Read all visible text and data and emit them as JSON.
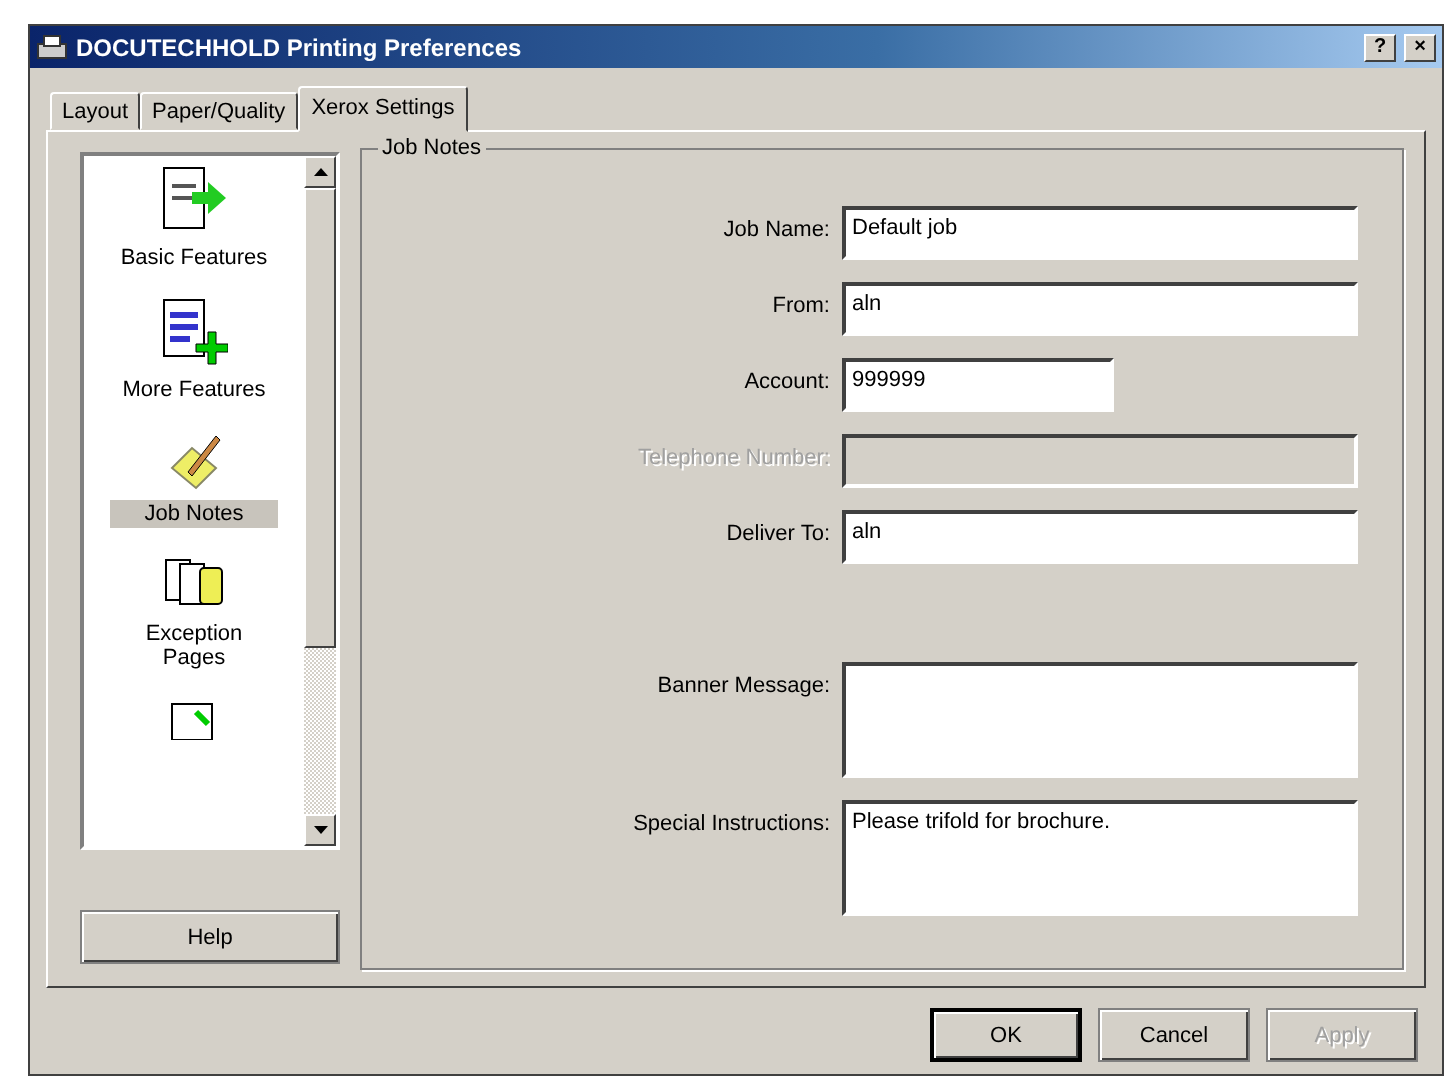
{
  "window": {
    "title": "DOCUTECHHOLD Printing Preferences",
    "help_button": "?",
    "close_button": "×"
  },
  "tabs": [
    {
      "label": "Layout",
      "selected": false
    },
    {
      "label": "Paper/Quality",
      "selected": false
    },
    {
      "label": "Xerox Settings",
      "selected": true
    }
  ],
  "sidebar": {
    "items": [
      {
        "label": "Basic Features",
        "selected": false
      },
      {
        "label": "More Features",
        "selected": false
      },
      {
        "label": "Job Notes",
        "selected": true
      },
      {
        "label": "Exception Pages",
        "selected": false
      }
    ],
    "help_button": "Help"
  },
  "group": {
    "title": "Job Notes",
    "fields": [
      {
        "kind": "text",
        "label": "Job Name:",
        "value": "Default job",
        "disabled": false
      },
      {
        "kind": "text",
        "label": "From:",
        "value": "aln",
        "disabled": false
      },
      {
        "kind": "short",
        "label": "Account:",
        "value": "999999",
        "disabled": false
      },
      {
        "kind": "text",
        "label": "Telephone Number:",
        "disabled": true
      },
      {
        "kind": "text",
        "label": "Deliver To:",
        "value": "aln",
        "disabled": false
      },
      {
        "kind": "multiline",
        "label": "Banner Message:",
        "disabled": false
      },
      {
        "kind": "multiline",
        "label": "Special Instructions:",
        "value": "Please trifold for brochure.",
        "disabled": false
      }
    ]
  },
  "buttons": [
    {
      "label": "OK",
      "default": true,
      "disabled": false
    },
    {
      "label": "Cancel",
      "default": false,
      "disabled": false
    },
    {
      "label": "Apply",
      "default": false,
      "disabled": true
    }
  ]
}
